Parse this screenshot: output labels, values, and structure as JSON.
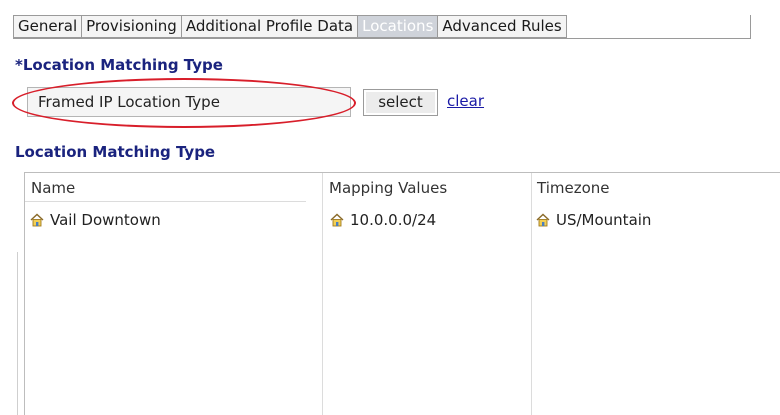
{
  "tabs": [
    "General",
    "Provisioning",
    "Additional Profile Data",
    "Locations",
    "Advanced Rules"
  ],
  "active_tab": "Locations",
  "location_matching": {
    "title": "*Location Matching Type",
    "value": "Framed IP Location Type",
    "select_label": "select",
    "clear_label": "clear"
  },
  "table": {
    "title": "Location Matching Type",
    "columns": [
      "Name",
      "Mapping Values",
      "Timezone"
    ],
    "rows": [
      {
        "name": "Vail Downtown",
        "mapping": "10.0.0.0/24",
        "timezone": "US/Mountain"
      }
    ]
  },
  "colors": {
    "accent": "#1a237e",
    "highlight": "#d81e2a",
    "link": "#1a1aa6",
    "active_tab": "#cfd3da"
  },
  "icons": [
    "home-icon"
  ]
}
